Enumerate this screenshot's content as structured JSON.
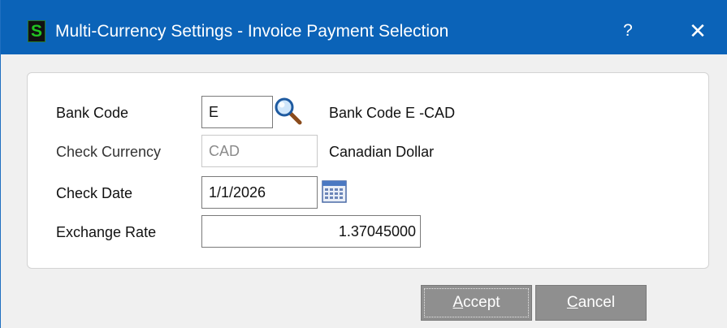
{
  "window": {
    "title": "Multi-Currency Settings - Invoice Payment Selection",
    "logo_letter": "S",
    "help_label": "?",
    "close_label": "✕",
    "colors": {
      "titlebar": "#0b63b8",
      "logo_green": "#22c322",
      "button_gray": "#8f8f8f"
    }
  },
  "form": {
    "bank_code": {
      "label": "Bank Code",
      "value": "E",
      "lookup_icon": "magnifier-icon",
      "description": "Bank Code E -CAD"
    },
    "check_currency": {
      "label": "Check Currency",
      "value": "CAD",
      "description": "Canadian Dollar"
    },
    "check_date": {
      "label": "Check Date",
      "value": "1/1/2026",
      "calendar_icon": "calendar-icon"
    },
    "exchange_rate": {
      "label": "Exchange Rate",
      "value": "1.37045000"
    }
  },
  "buttons": {
    "accept": {
      "accel": "A",
      "rest": "ccept"
    },
    "cancel": {
      "accel": "C",
      "rest": "ancel"
    }
  }
}
